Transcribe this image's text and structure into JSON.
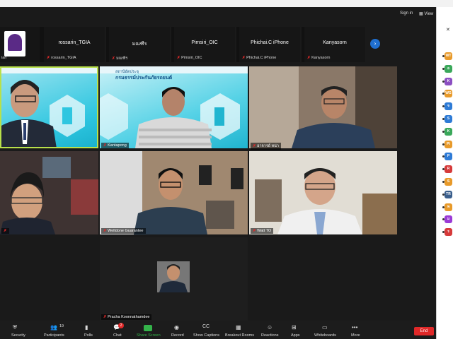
{
  "titlebar": {
    "sign_in": "Sign in",
    "view": "View"
  },
  "gallery_strip": {
    "first_label": "ian",
    "thumbs": [
      {
        "name": "rossarin_TGIA",
        "label": "rossarin_TGIA"
      },
      {
        "name": "มณฑีร",
        "label": "มณฑีร"
      },
      {
        "name": "Pimsiri_OIC",
        "label": "Pimsiri_OIC"
      },
      {
        "name": "Phichai.C iPhone",
        "label": "Phichai.C iPhone"
      },
      {
        "name": "Kanyasorn",
        "label": "Kanyasorn"
      }
    ],
    "next_icon": "chevron-right-icon"
  },
  "tiles": [
    {
      "label": "",
      "active": true
    },
    {
      "label": "Kantapong",
      "active": false
    },
    {
      "label": "อาจารย์ หน่า",
      "active": false
    },
    {
      "label": "",
      "active": false
    },
    {
      "label": "Welldone Guarantee",
      "active": false
    },
    {
      "label": "Watt TO",
      "active": false
    },
    {
      "label": "Pracha Koonnathamdee",
      "active": false
    }
  ],
  "slide_text": {
    "line1": "สถานีอัดประจุ",
    "line2": "กรมธรรม์ประกันภัยรถยนต์"
  },
  "toolbar": {
    "security": "Security",
    "participants": "Participants",
    "participants_count": "19",
    "polls": "Polls",
    "chat": "Chat",
    "chat_badge": "2",
    "share": "Share Screen",
    "record": "Record",
    "captions": "Show Captions",
    "breakout": "Breakout Rooms",
    "reactions": "Reactions",
    "apps": "Apps",
    "whiteboards": "Whiteboards",
    "more": "More",
    "end": "End"
  },
  "right_panel": {
    "avatars": [
      "WT",
      "อ",
      "K",
      "WG",
      "จ",
      "S",
      "K",
      "Pi",
      "P",
      "R",
      "S",
      "TR",
      "พ",
      "ม",
      "ร"
    ],
    "colors": [
      "#e89a2a",
      "#3aa85a",
      "#8c4fc2",
      "#e89a2a",
      "#2e7bd6",
      "#2e7bd6",
      "#3aa85a",
      "#e89a2a",
      "#2e7bd6",
      "#d63a3a",
      "#e89a2a",
      "#3a5e8c",
      "#e89a2a",
      "#9b3ad6",
      "#d63a3a"
    ]
  },
  "colors": {
    "accent": "#2d8cff",
    "end": "#e02828",
    "active_speaker": "#b8e04a"
  }
}
